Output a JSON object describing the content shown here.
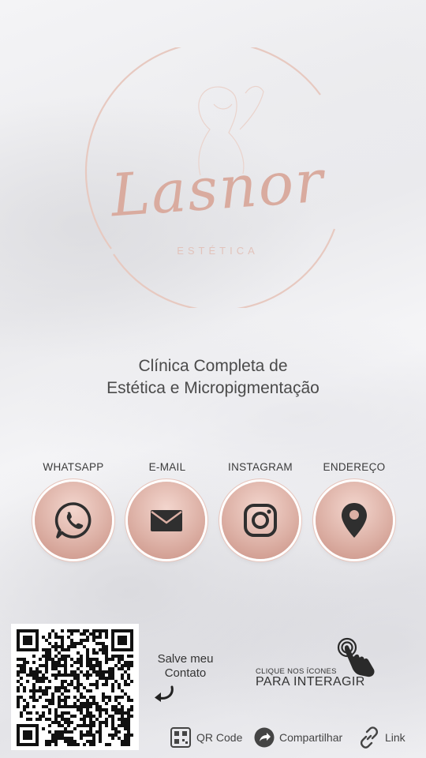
{
  "brand": {
    "name": "Lasnor",
    "subtitle": "ESTÉTICA",
    "accent_color": "#d9ab9f"
  },
  "tagline": {
    "line1": "Clínica Completa de",
    "line2": "Estética e Micropigmentação"
  },
  "contacts": [
    {
      "label": "WHATSAPP",
      "icon": "whatsapp-icon"
    },
    {
      "label": "E-MAIL",
      "icon": "mail-icon"
    },
    {
      "label": "INSTAGRAM",
      "icon": "instagram-icon"
    },
    {
      "label": "ENDEREÇO",
      "icon": "location-pin-icon"
    }
  ],
  "save_contact": {
    "line1": "Salve meu",
    "line2": "Contato"
  },
  "interact_hint": {
    "small": "CLIQUE NOS ÍCONES",
    "big": "PARA INTERAGIR"
  },
  "bottom_bar": {
    "qr_code": "QR Code",
    "share": "Compartilhar",
    "link": "Link"
  }
}
